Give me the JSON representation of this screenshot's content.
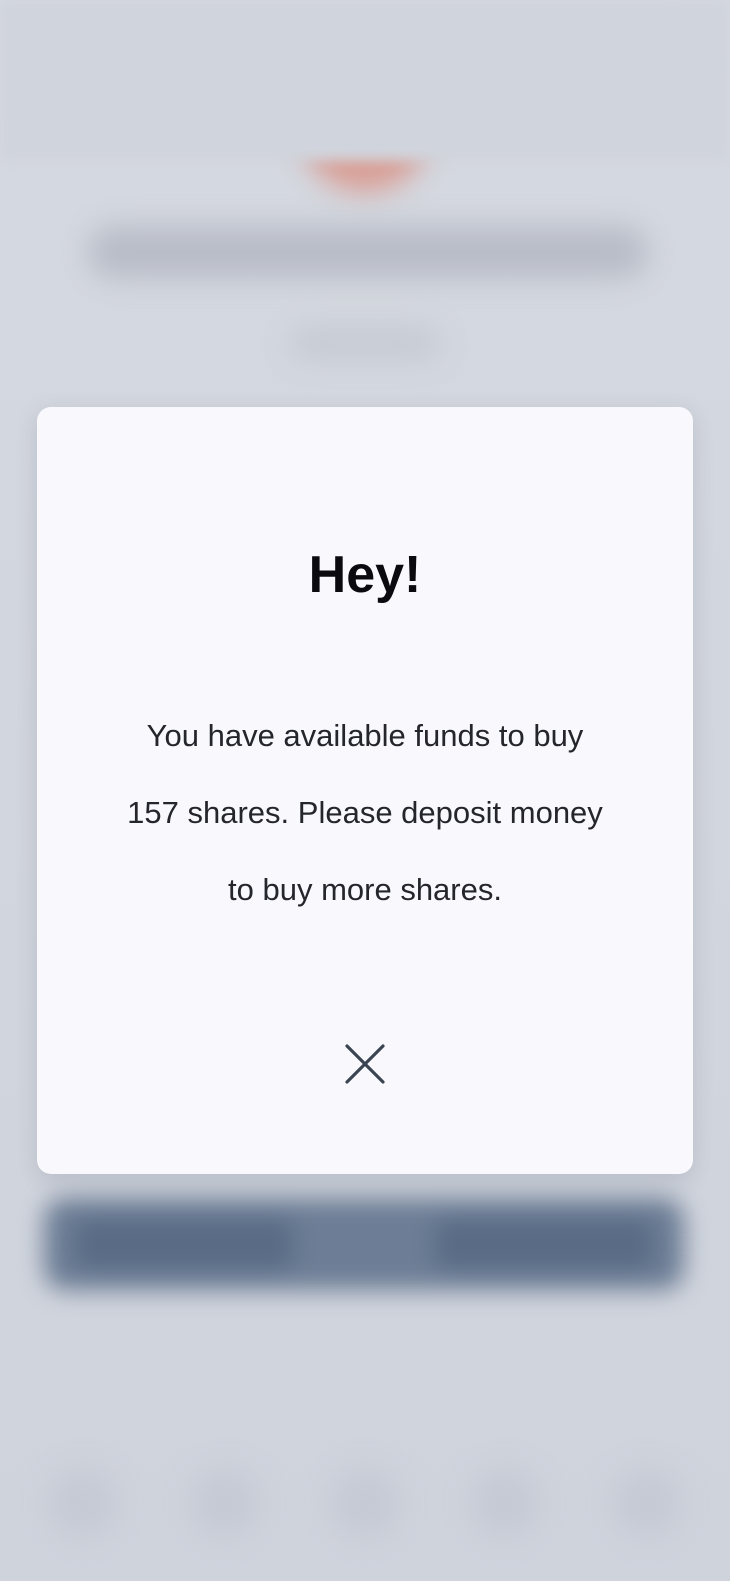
{
  "modal": {
    "title": "Hey!",
    "message": "You have available funds to buy 157 shares. Please deposit money to buy more shares.",
    "close_icon": "close-icon"
  },
  "colors": {
    "modal_background": "#f9f9fd",
    "title_text": "#0b0b0f",
    "body_text": "#25262b",
    "close_icon": "#3b4552",
    "backdrop": "#d3d7df"
  }
}
